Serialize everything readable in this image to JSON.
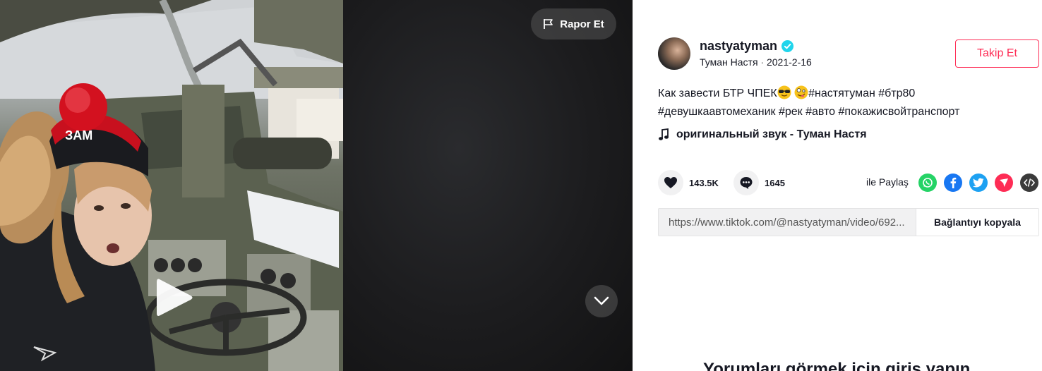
{
  "video": {
    "report_label": "Rapor Et"
  },
  "author": {
    "username": "nastyatyman",
    "display_name": "Туман Настя",
    "separator": "·",
    "date": "2021-2-16"
  },
  "follow": {
    "label": "Takip Et"
  },
  "caption": {
    "text": "Как завести БТР ЧПЕК",
    "hashtags_line1": "#настятуман #бтр80",
    "hashtags_line2": "#девушкаавтомеханик #рек #авто #покажисвойтранспорт"
  },
  "music": {
    "title": "оригинальный звук - Туман Настя"
  },
  "stats": {
    "likes": "143.5K",
    "comments": "1645"
  },
  "share": {
    "label": "ile Paylaş",
    "icons": [
      "whatsapp-icon",
      "facebook-icon",
      "twitter-icon",
      "send-icon",
      "embed-icon"
    ]
  },
  "link": {
    "url": "https://www.tiktok.com/@nastyatyman/video/692...",
    "copy_label": "Bağlantıyı kopyala"
  },
  "comments_login": {
    "text": "Yorumları görmek için giriş yapın"
  },
  "colors": {
    "accent": "#fe2c55",
    "verified": "#20d5ec",
    "whatsapp": "#25d366",
    "facebook": "#1877f2",
    "twitter": "#1da1f2",
    "send": "#fe2c55",
    "embed": "#3a3a3a"
  }
}
